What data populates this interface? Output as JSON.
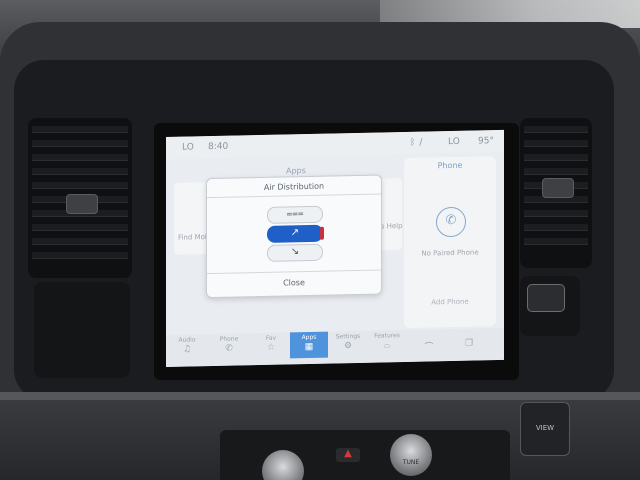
{
  "status": {
    "lo_left": "LO",
    "time": "8:40",
    "lo_right": "LO",
    "temp": "95°"
  },
  "apps": {
    "title": "Apps",
    "find_label": "Find Mob",
    "help_label": "nos Help"
  },
  "phone": {
    "title": "Phone",
    "no_paired": "No Paired Phone",
    "add_phone": "Add Phone"
  },
  "dialog": {
    "title": "Air Distribution",
    "close_label": "Close",
    "options": [
      {
        "icon": "defrost-icon",
        "glyph": "⩶",
        "selected": false
      },
      {
        "icon": "panel-airflow-icon",
        "glyph": "↗",
        "selected": true
      },
      {
        "icon": "floor-airflow-icon",
        "glyph": "↘",
        "selected": false
      }
    ]
  },
  "nav": {
    "items": [
      {
        "label": "Audio",
        "icon": "music-note-icon",
        "glyph": "♫"
      },
      {
        "label": "Phone",
        "icon": "phone-icon",
        "glyph": "✆"
      },
      {
        "label": "Fav",
        "icon": "star-icon",
        "glyph": "☆"
      },
      {
        "label": "Apps",
        "icon": "grid-icon",
        "glyph": "▦",
        "active": true
      },
      {
        "label": "Settings",
        "icon": "gear-icon",
        "glyph": "⚙"
      },
      {
        "label": "Features",
        "icon": "car-icon",
        "glyph": "⌓"
      }
    ]
  },
  "controls": {
    "tune_label": "TUNE",
    "right_button_label": "VIEW"
  },
  "colors": {
    "accent": "#4f93dc",
    "selected": "#1f5fc8",
    "screen_bg": "#e9ecf0"
  }
}
